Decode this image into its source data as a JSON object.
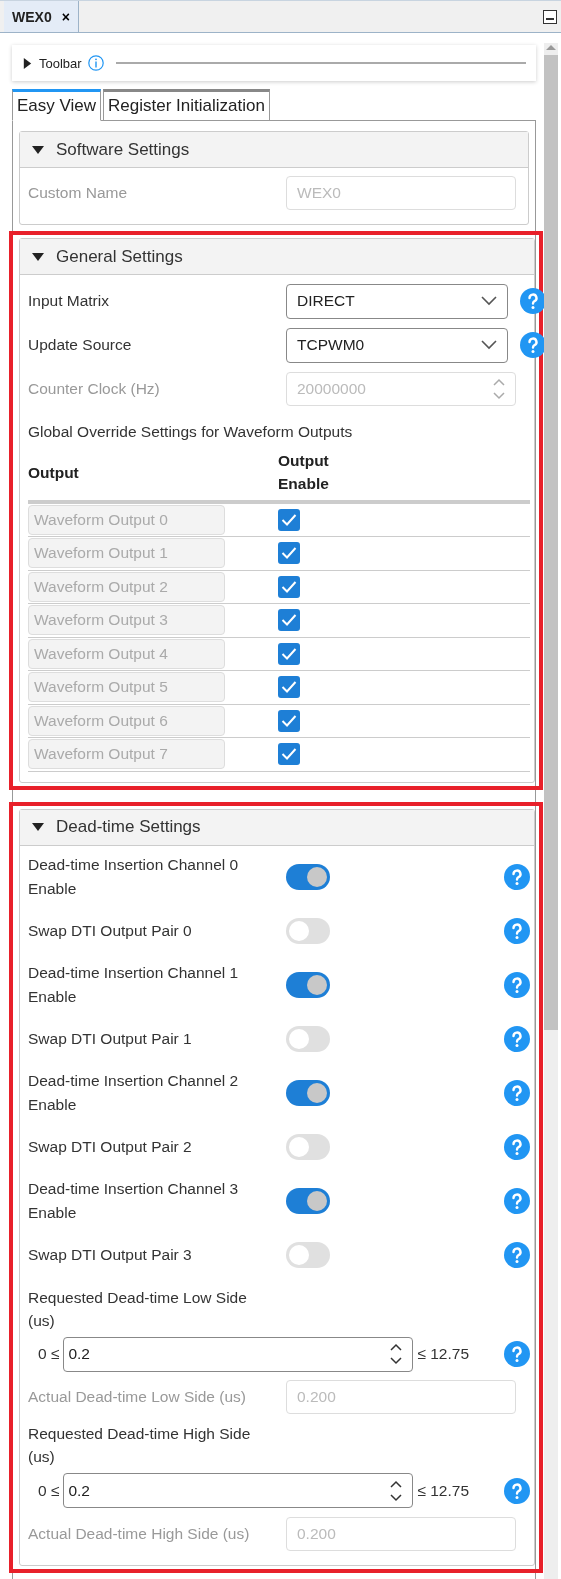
{
  "editor_tab": {
    "title": "WEX0",
    "close": "×"
  },
  "toolbar": {
    "label": "Toolbar",
    "expanded": false
  },
  "view_tabs": [
    {
      "label": "Easy View",
      "selected": true
    },
    {
      "label": "Register Initialization",
      "selected": false
    }
  ],
  "sections": [
    {
      "title": "Software Settings",
      "expanded": true,
      "highlighted": false,
      "rows": [
        {
          "kind": "text",
          "label": "Custom Name",
          "value": "WEX0",
          "disabled": true,
          "help": false
        }
      ]
    },
    {
      "title": "General Settings",
      "expanded": true,
      "highlighted": true,
      "rows": [
        {
          "kind": "select",
          "label": "Input Matrix",
          "value": "DIRECT",
          "disabled": false,
          "help": true
        },
        {
          "kind": "select",
          "label": "Update Source",
          "value": "TCPWM0",
          "disabled": false,
          "help": true
        },
        {
          "kind": "spin",
          "label": "Counter Clock (Hz)",
          "value": "20000000",
          "disabled": true,
          "help": false
        },
        {
          "kind": "note",
          "label": "Global Override Settings for Waveform Outputs"
        },
        {
          "kind": "table",
          "columns": [
            "Output",
            "Output Enable"
          ],
          "items": [
            {
              "name": "Waveform Output 0",
              "checked": true
            },
            {
              "name": "Waveform Output 1",
              "checked": true
            },
            {
              "name": "Waveform Output 2",
              "checked": true
            },
            {
              "name": "Waveform Output 3",
              "checked": true
            },
            {
              "name": "Waveform Output 4",
              "checked": true
            },
            {
              "name": "Waveform Output 5",
              "checked": true
            },
            {
              "name": "Waveform Output 6",
              "checked": true
            },
            {
              "name": "Waveform Output 7",
              "checked": true
            }
          ]
        }
      ]
    },
    {
      "title": "Dead-time Settings",
      "expanded": true,
      "highlighted": true,
      "rows": [
        {
          "kind": "toggle",
          "label": "Dead-time Insertion Channel 0 Enable",
          "on": true,
          "help": true
        },
        {
          "kind": "toggle",
          "label": "Swap DTI Output Pair 0",
          "on": false,
          "help": true
        },
        {
          "kind": "toggle",
          "label": "Dead-time Insertion Channel 1 Enable",
          "on": true,
          "help": true
        },
        {
          "kind": "toggle",
          "label": "Swap DTI Output Pair 1",
          "on": false,
          "help": true
        },
        {
          "kind": "toggle",
          "label": "Dead-time Insertion Channel 2 Enable",
          "on": true,
          "help": true
        },
        {
          "kind": "toggle",
          "label": "Swap DTI Output Pair 2",
          "on": false,
          "help": true
        },
        {
          "kind": "toggle",
          "label": "Dead-time Insertion Channel 3 Enable",
          "on": true,
          "help": true
        },
        {
          "kind": "toggle",
          "label": "Swap DTI Output Pair 3",
          "on": false,
          "help": true
        },
        {
          "kind": "range",
          "label": "Requested Dead-time Low Side (us)",
          "min": "0 ≤",
          "value": "0.2",
          "max": "≤ 12.75",
          "help": true
        },
        {
          "kind": "text",
          "label": "Actual Dead-time Low Side (us)",
          "value": "0.200",
          "disabled": true,
          "help": false
        },
        {
          "kind": "range",
          "label": "Requested Dead-time High Side (us)",
          "min": "0 ≤",
          "value": "0.2",
          "max": "≤ 12.75",
          "help": true
        },
        {
          "kind": "text",
          "label": "Actual Dead-time High Side (us)",
          "value": "0.200",
          "disabled": true,
          "help": false
        }
      ]
    }
  ]
}
